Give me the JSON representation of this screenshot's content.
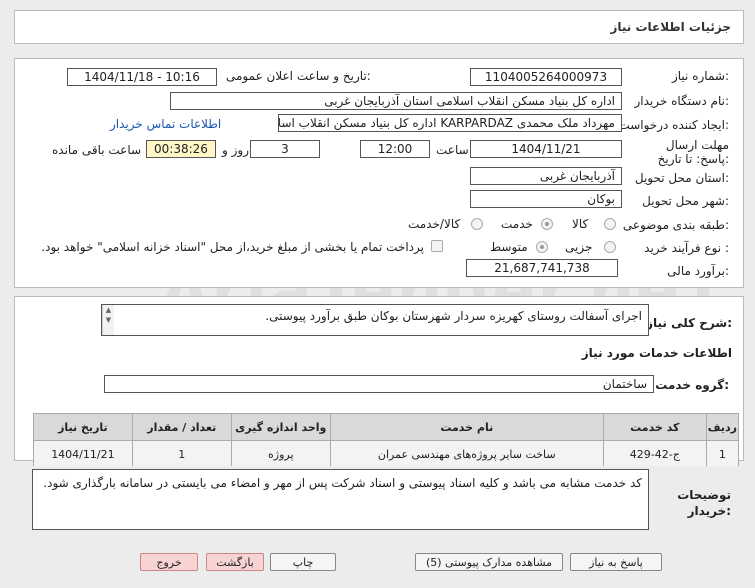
{
  "header": {
    "title": "جزئیات اطلاعات نیاز"
  },
  "form": {
    "need_number_label": "شماره نیاز:",
    "need_number": "1104005264000973",
    "announce_label": "تاریخ و ساعت اعلان عمومی:",
    "announce_value": "1404/11/18 - 10:16",
    "buyer_org_label": "نام دستگاه خریدار:",
    "buyer_org": "اداره کل بنیاد مسکن انقلاب اسلامی استان آذربایجان غربی",
    "requester_label": "ایجاد کننده درخواست:",
    "requester": "مهرداد ملک محمدی KARPARDAZ اداره کل بنیاد مسکن انقلاب اسلامی استان آ",
    "contact_link": "اطلاعات تماس خریدار",
    "deadline_label": "مهلت ارسال پاسخ: تا تاریخ:",
    "deadline_date": "1404/11/21",
    "time_label": "ساعت",
    "deadline_time": "12:00",
    "days_value": "3",
    "days_label": "روز و",
    "remaining_time": "00:38:26",
    "remaining_label": "ساعت باقی مانده",
    "province_label": "استان محل تحویل:",
    "province": "آذربایجان غربی",
    "city_label": "شهر محل تحویل:",
    "city": "بوکان",
    "category_label": "طبقه بندی موضوعی:",
    "category_options": [
      "کالا",
      "خدمت",
      "کالا/خدمت"
    ],
    "process_label": "نوع فرآیند خرید :",
    "process_options": [
      "جزیی",
      "متوسط"
    ],
    "payment_note": "پرداخت تمام یا بخشی از مبلغ خرید،از محل \"اسناد خزانه اسلامی\" خواهد بود.",
    "budget_label": "برآورد مالی:",
    "budget": "21,687,741,738"
  },
  "description": {
    "label": "شرح کلی نیاز:",
    "text": "اجرای آسفالت روستای کهریزه سردار شهرستان بوکان طبق برآورد پیوستی."
  },
  "services": {
    "section_title": "اطلاعات خدمات مورد نیاز",
    "group_label": "گروه خدمت:",
    "group_value": "ساختمان",
    "columns": [
      "ردیف",
      "کد خدمت",
      "نام خدمت",
      "واحد اندازه گیری",
      "تعداد / مقدار",
      "تاریخ نیاز"
    ],
    "rows": [
      [
        "1",
        "ج-42-429",
        "ساخت سایر پروژه‌های مهندسی عمران",
        "پروژه",
        "1",
        "1404/11/21"
      ]
    ]
  },
  "buyer_notes": {
    "label_line1": "توضیحات",
    "label_line2": "خریدار:",
    "text": "کد خدمت مشابه می باشد و کلیه اسناد پیوستی و اسناد شرکت پس از مهر و امضاء می بایستی در سامانه بارگذاری شود."
  },
  "buttons": {
    "reply": "پاسخ به نیاز",
    "attachments": "مشاهده مدارک پیوستی (5)",
    "print": "چاپ",
    "back": "بازگشت",
    "exit": "خروج"
  },
  "watermark": "AriaTender.neT",
  "colors": {
    "link": "#1a55b0",
    "danger_button": "#f8d3d3"
  }
}
